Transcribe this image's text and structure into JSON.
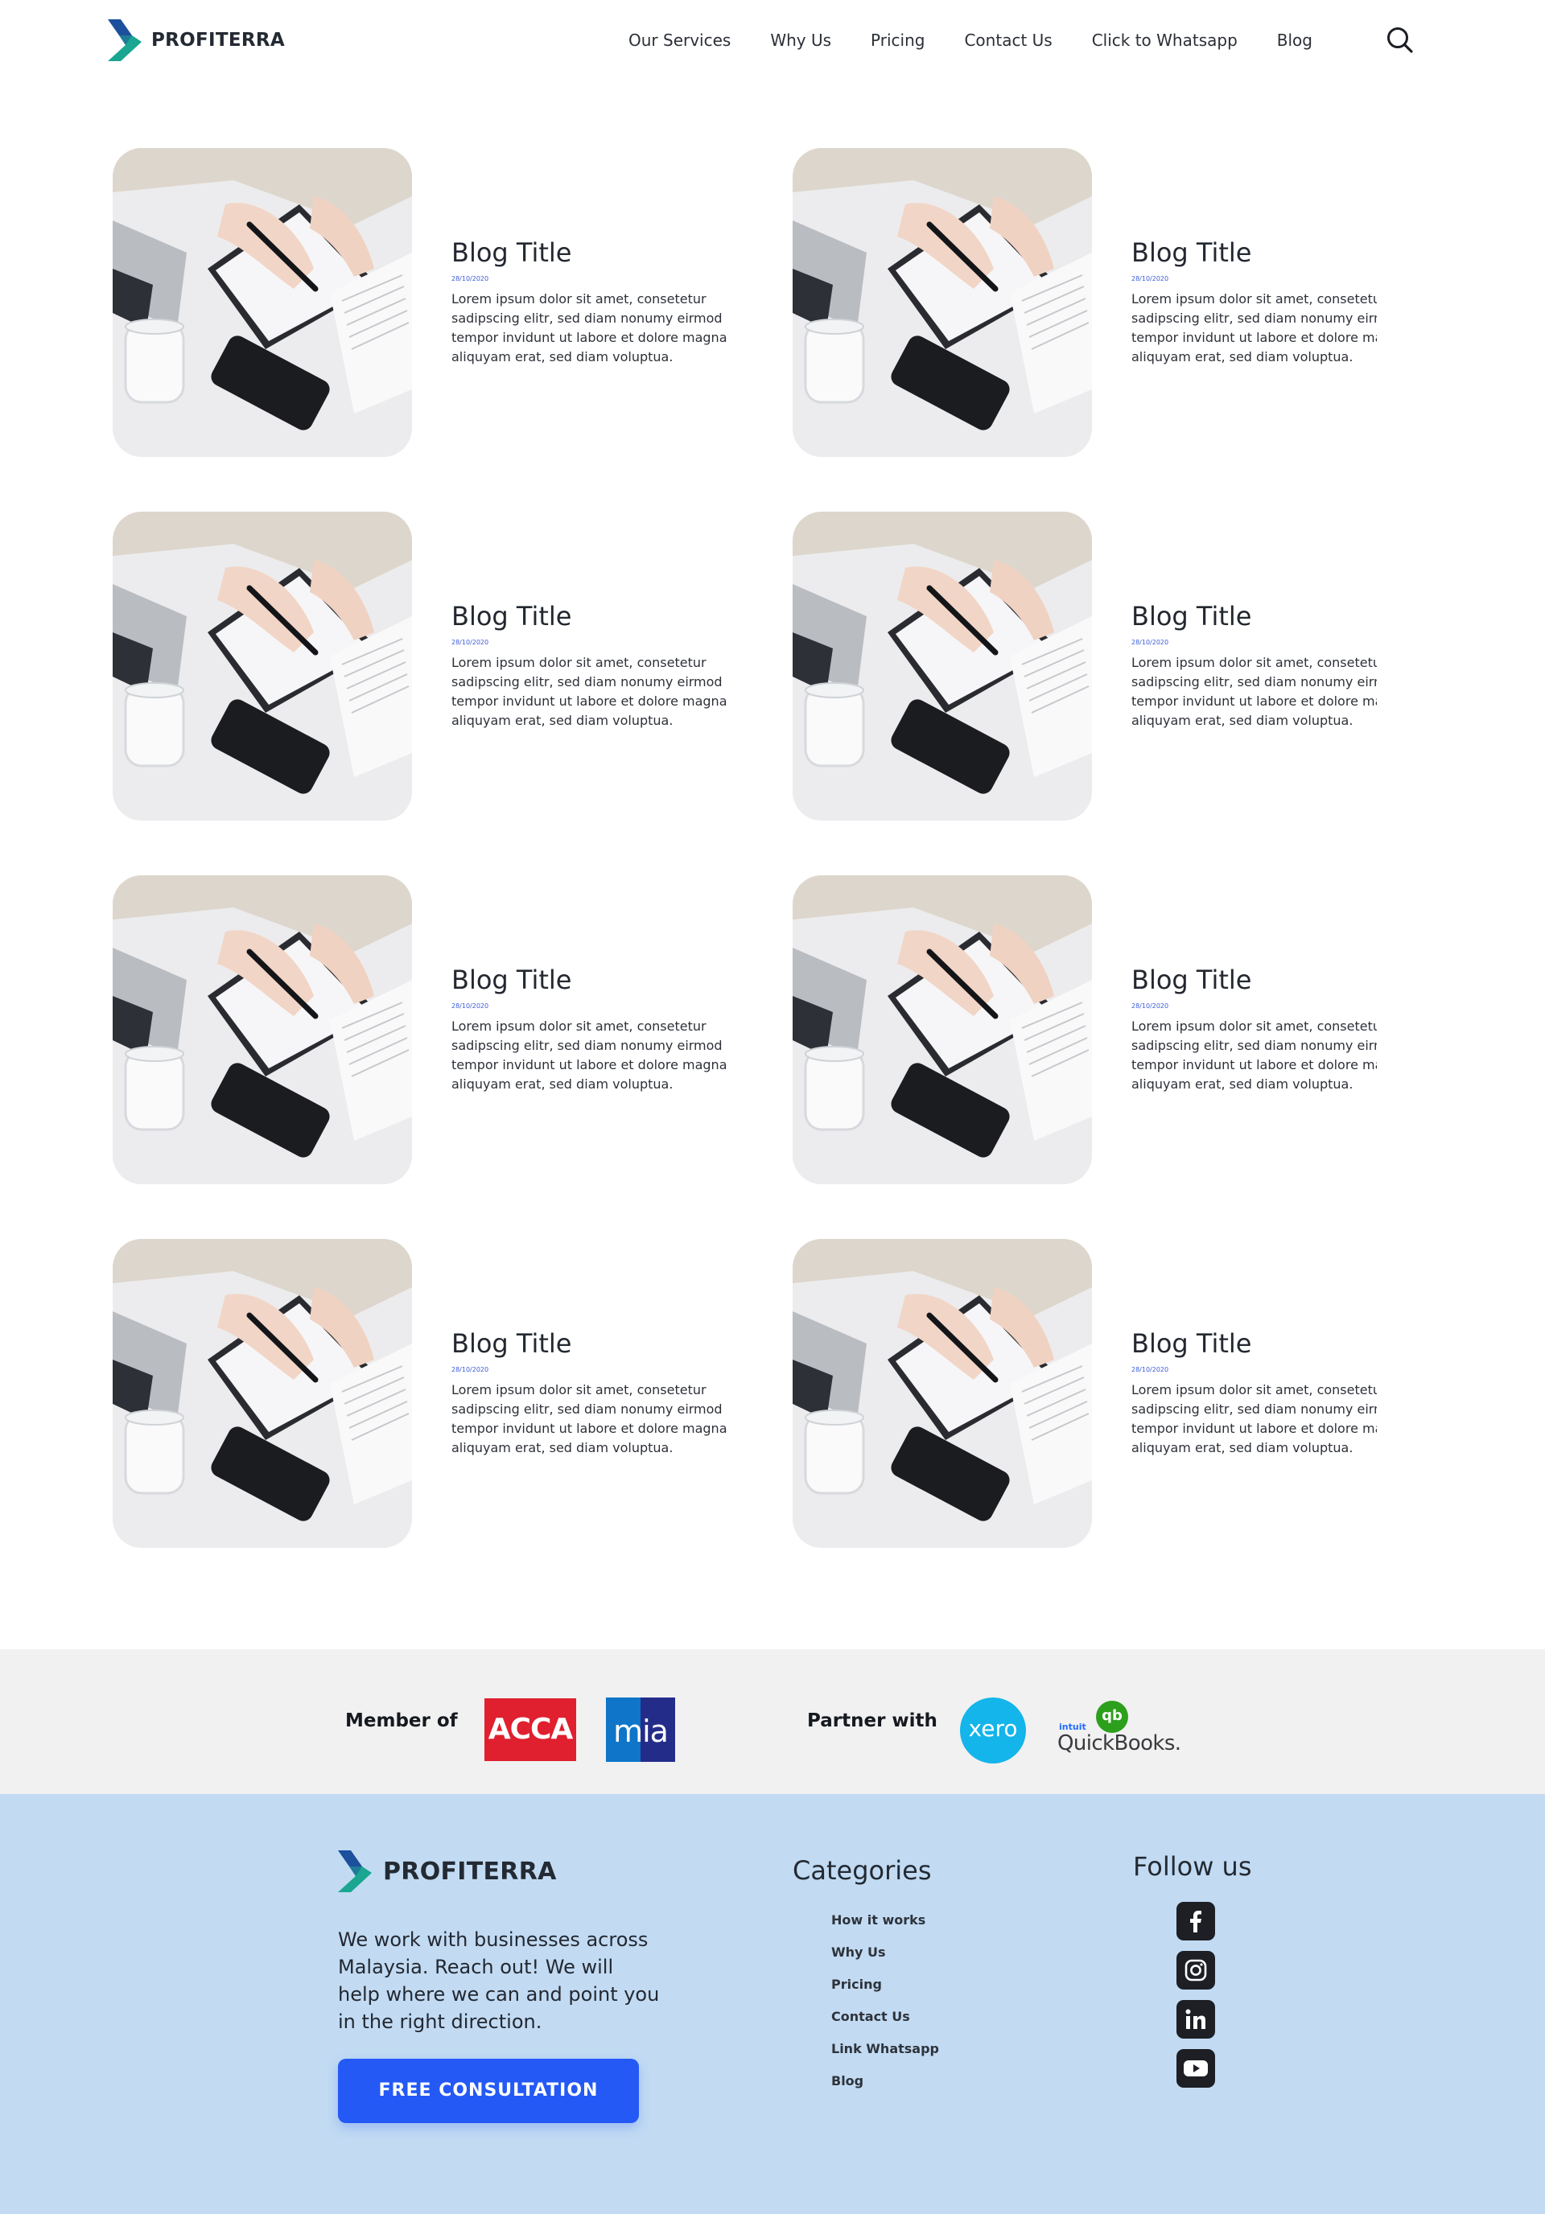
{
  "header": {
    "brand": "PROFITERRA",
    "nav": [
      "Our Services",
      "Why Us",
      "Pricing",
      "Contact Us",
      "Click to Whatsapp",
      "Blog"
    ],
    "search_icon": "search-icon"
  },
  "blog": {
    "posts": [
      {
        "title": "Blog Title",
        "date": "28/10/2020",
        "excerpt": "Lorem ipsum dolor sit amet, consetetur sadipscing elitr, sed diam nonumy eirmod tempor invidunt ut labore et dolore magna aliquyam erat, sed diam voluptua."
      },
      {
        "title": "Blog Title",
        "date": "28/10/2020",
        "excerpt": "Lorem ipsum dolor sit amet, consetetur sadipscing elitr, sed diam nonumy eirmod tempor invidunt ut labore et dolore magna aliquyam erat, sed diam voluptua."
      },
      {
        "title": "Blog Title",
        "date": "28/10/2020",
        "excerpt": "Lorem ipsum dolor sit amet, consetetur sadipscing elitr, sed diam nonumy eirmod tempor invidunt ut labore et dolore magna aliquyam erat, sed diam voluptua."
      },
      {
        "title": "Blog Title",
        "date": "28/10/2020",
        "excerpt": "Lorem ipsum dolor sit amet, consetetur sadipscing elitr, sed diam nonumy eirmod tempor invidunt ut labore et dolore magna aliquyam erat, sed diam voluptua."
      },
      {
        "title": "Blog Title",
        "date": "28/10/2020",
        "excerpt": "Lorem ipsum dolor sit amet, consetetur sadipscing elitr, sed diam nonumy eirmod tempor invidunt ut labore et dolore magna aliquyam erat, sed diam voluptua."
      },
      {
        "title": "Blog Title",
        "date": "28/10/2020",
        "excerpt": "Lorem ipsum dolor sit amet, consetetur sadipscing elitr, sed diam nonumy eirmod tempor invidunt ut labore et dolore magna aliquyam erat, sed diam voluptua."
      },
      {
        "title": "Blog Title",
        "date": "28/10/2020",
        "excerpt": "Lorem ipsum dolor sit amet, consetetur sadipscing elitr, sed diam nonumy eirmod tempor invidunt ut labore et dolore magna aliquyam erat, sed diam voluptua."
      },
      {
        "title": "Blog Title",
        "date": "28/10/2020",
        "excerpt": "Lorem ipsum dolor sit amet, consetetur sadipscing elitr, sed diam nonumy eirmod tempor invidunt ut labore et dolore magna aliquyam erat, sed diam voluptua."
      }
    ]
  },
  "partners": {
    "member_label": "Member of",
    "member_logos": [
      "ACCA",
      "mia"
    ],
    "partner_label": "Partner with",
    "partner_logos": [
      "xero",
      "qb",
      "intuit",
      "QuickBooks."
    ]
  },
  "footer": {
    "brand": "PROFITERRA",
    "blurb": "We work with businesses across Malaysia. Reach out! We will help where we can and point you in the right direction.",
    "cta_label": "FREE CONSULTATION",
    "categories_title": "Categories",
    "categories": [
      "How it works",
      "Why Us",
      "Pricing",
      "Contact Us",
      "Link Whatsapp",
      "Blog"
    ],
    "follow_title": "Follow us",
    "social_icons": [
      "facebook-icon",
      "instagram-icon",
      "linkedin-icon",
      "youtube-icon"
    ]
  },
  "colors": {
    "accent_blue": "#2459f6",
    "footer_bg": "#c2dbf3",
    "partners_bg": "#f1f1f1",
    "logo_green": "#1aa690",
    "logo_blue": "#1c4f9c",
    "date_blue": "#3b5bd9"
  }
}
